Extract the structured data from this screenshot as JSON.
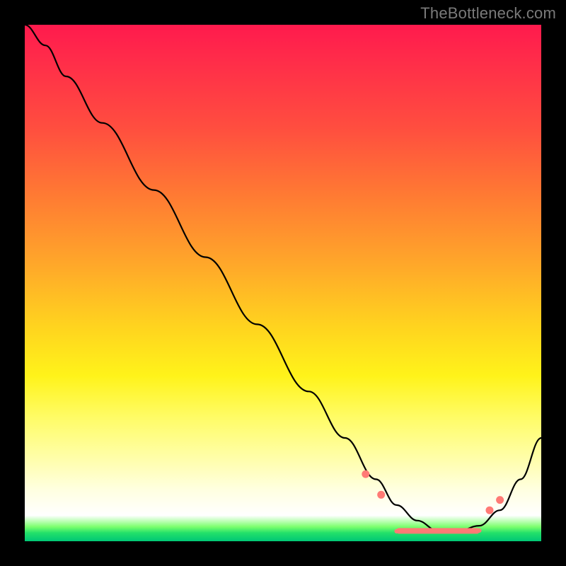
{
  "watermark": "TheBottleneck.com",
  "chart_data": {
    "type": "line",
    "title": "",
    "xlabel": "",
    "ylabel": "",
    "xlim": [
      0,
      100
    ],
    "ylim": [
      0,
      100
    ],
    "grid": false,
    "legend": false,
    "series": [
      {
        "name": "bottleneck-curve",
        "x": [
          0,
          4,
          8,
          15,
          25,
          35,
          45,
          55,
          62,
          68,
          72,
          76,
          80,
          84,
          88,
          92,
          96,
          100
        ],
        "y": [
          100,
          96,
          90,
          81,
          68,
          55,
          42,
          29,
          20,
          12,
          7,
          4,
          2,
          2,
          3,
          6,
          12,
          20
        ],
        "color": "#000000"
      }
    ],
    "markers": {
      "color": "#ff7a75",
      "points": [
        {
          "x": 66,
          "y": 13,
          "size": "lg"
        },
        {
          "x": 69,
          "y": 9,
          "size": "lg"
        },
        {
          "x": 90,
          "y": 6,
          "size": "lg"
        },
        {
          "x": 92,
          "y": 8,
          "size": "lg"
        }
      ],
      "valley_band": {
        "x_start": 72,
        "x_end": 88,
        "y": 2
      }
    },
    "background_gradient": {
      "top": "#ff1a4d",
      "mid_upper": "#ff7a33",
      "mid": "#fff31a",
      "mid_lower": "#ffffe0",
      "bottom_band": "#00c775"
    }
  }
}
